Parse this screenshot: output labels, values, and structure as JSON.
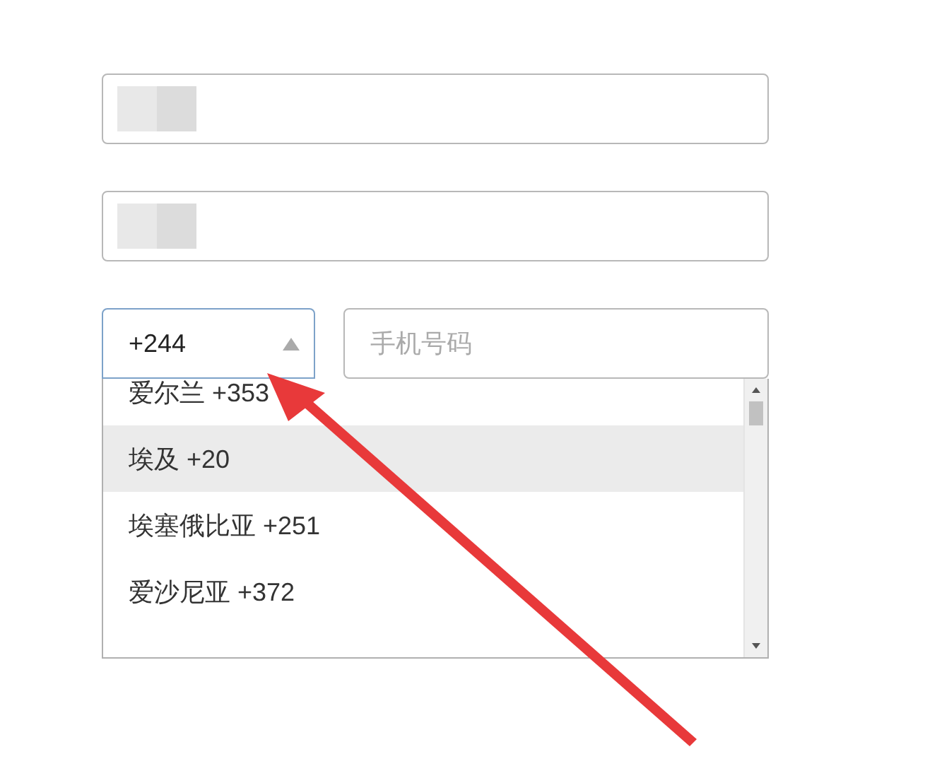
{
  "text_fields": [
    {
      "blurred": true
    },
    {
      "blurred": true
    }
  ],
  "country_code": {
    "value": "+244",
    "open": true
  },
  "phone": {
    "placeholder": "手机号码"
  },
  "options": [
    {
      "label": "爱尔兰 +353",
      "selected": false
    },
    {
      "label": "埃及 +20",
      "selected": true
    },
    {
      "label": "埃塞俄比亚 +251",
      "selected": false
    },
    {
      "label": "爱沙尼亚 +372",
      "selected": false
    }
  ],
  "annotation": {
    "kind": "arrow"
  }
}
